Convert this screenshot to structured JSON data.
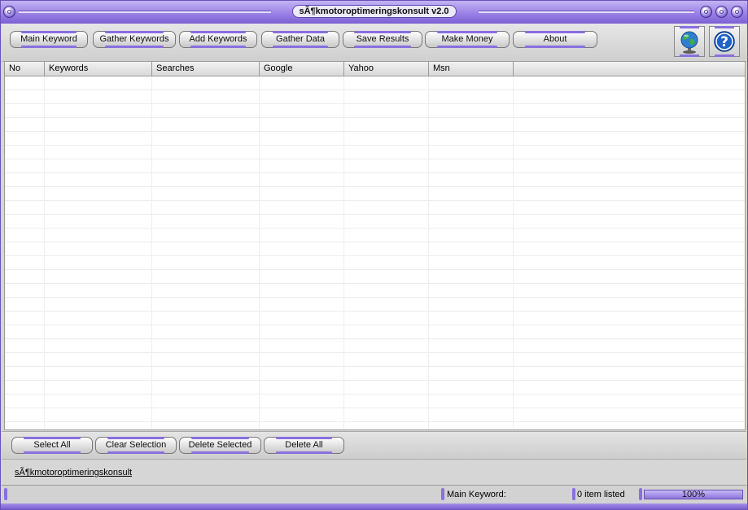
{
  "window": {
    "title": "sÃ¶kmotoroptimeringskonsult v2.0"
  },
  "toolbar": {
    "buttons": [
      {
        "label": "Main Keyword"
      },
      {
        "label": "Gather Keywords"
      },
      {
        "label": "Add Keywords"
      },
      {
        "label": "Gather Data"
      },
      {
        "label": "Save Results"
      },
      {
        "label": "Make Money"
      },
      {
        "label": "About"
      }
    ],
    "icons": [
      "globe-icon",
      "help-icon"
    ]
  },
  "table": {
    "columns": [
      "No",
      "Keywords",
      "Searches",
      "Google",
      "Yahoo",
      "Msn"
    ],
    "rows": []
  },
  "actions": {
    "buttons": [
      {
        "label": "Select All"
      },
      {
        "label": "Clear Selection"
      },
      {
        "label": "Delete Selected"
      },
      {
        "label": "Delete All"
      }
    ]
  },
  "footer_link": "sÃ¶kmotoroptimeringskonsult",
  "status": {
    "main_keyword": "Main Keyword:",
    "items_listed": "0 item listed",
    "progress_percent": 100,
    "progress_label": "100%"
  },
  "colors": {
    "accent": "#8a6fe0",
    "title_bar": "#9a82e6"
  }
}
